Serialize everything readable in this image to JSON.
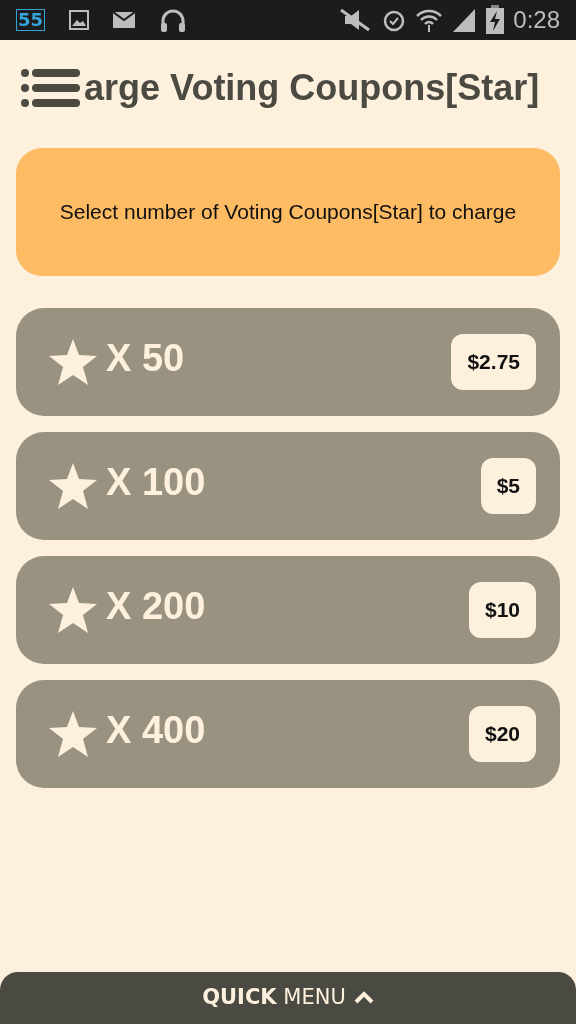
{
  "status_bar": {
    "notification_count": "55",
    "time": "0:28"
  },
  "header": {
    "title": "arge Voting Coupons[Star]"
  },
  "notice": {
    "text": "Select number of Voting Coupons[Star] to charge"
  },
  "packages": [
    {
      "quantity": "X 50",
      "price": "$2.75"
    },
    {
      "quantity": "X 100",
      "price": "$5"
    },
    {
      "quantity": "X 200",
      "price": "$10"
    },
    {
      "quantity": "X 400",
      "price": "$20"
    }
  ],
  "quick_menu": {
    "label": "**QUICK** MENU"
  }
}
